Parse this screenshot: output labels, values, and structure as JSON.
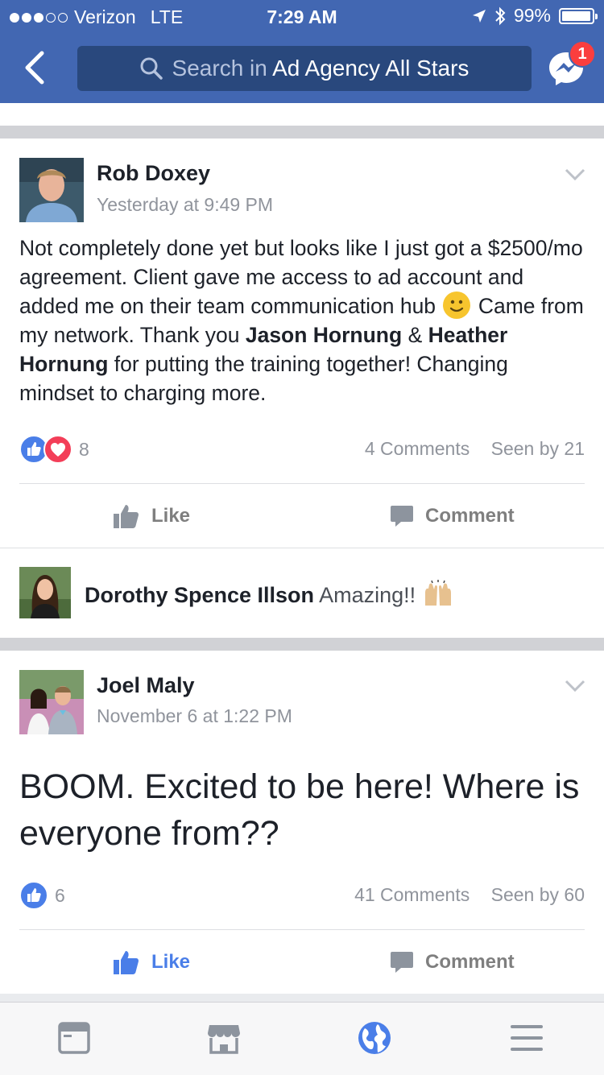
{
  "status_bar": {
    "carrier": "Verizon",
    "network": "LTE",
    "time": "7:29 AM",
    "battery": "99%"
  },
  "nav": {
    "search_prefix": "Search in",
    "search_group": "Ad Agency All Stars",
    "messenger_badge": "1"
  },
  "posts": [
    {
      "author": "Rob Doxey",
      "time": "Yesterday at 9:49 PM",
      "body_part1": "Not completely done yet but looks like I just got a $2500/mo agreement. Client gave me access to ad account and added me on their team communication hub",
      "body_part2": "Came from my network. Thank you",
      "tag1": "Jason Hornung",
      "amp": "&",
      "tag2": "Heather Hornung",
      "body_part3": "for putting the training together! Changing mindset to charging more.",
      "reaction_count": "8",
      "comments": "4 Comments",
      "seen": "Seen by 21",
      "like_label": "Like",
      "comment_label": "Comment",
      "top_comment": {
        "author": "Dorothy Spence Illson",
        "text": "Amazing!!"
      }
    },
    {
      "author": "Joel Maly",
      "time": "November 6 at 1:22 PM",
      "body": "BOOM. Excited to be here! Where is everyone from??",
      "reaction_count": "6",
      "comments": "41 Comments",
      "seen": "Seen by 60",
      "like_label": "Like",
      "comment_label": "Comment"
    }
  ],
  "tabs": [
    "news-feed-icon",
    "marketplace-icon",
    "globe-icon",
    "menu-icon"
  ],
  "colors": {
    "brand": "#4267b2",
    "search_bg": "#29487d",
    "like_blue": "#4a7ee8",
    "love_red": "#f33e58",
    "badge_red": "#fa3e3e",
    "muted_text": "#90949c"
  }
}
